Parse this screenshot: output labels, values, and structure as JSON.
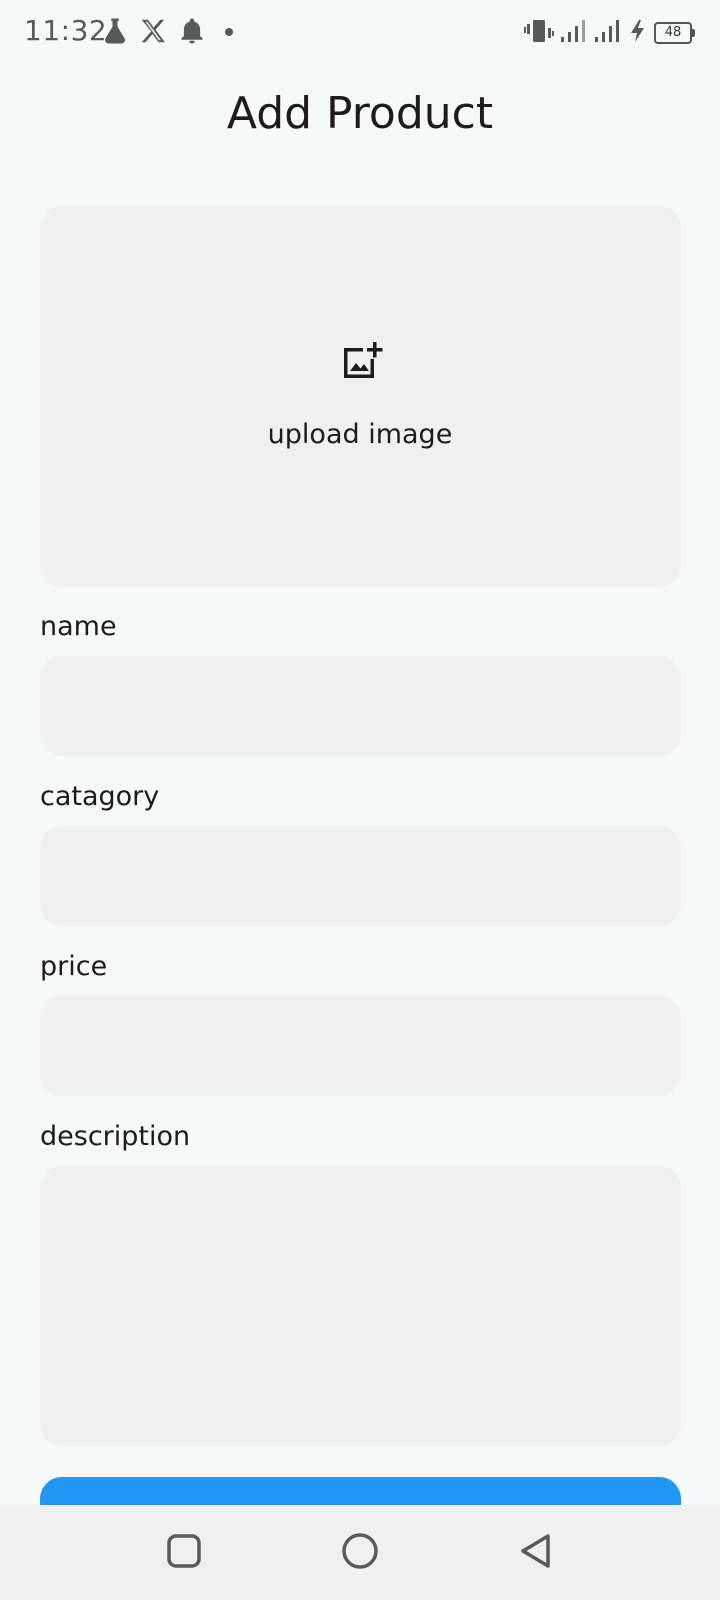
{
  "status_bar": {
    "time": "11:32",
    "battery_level": "48",
    "left_icons": [
      "flask-icon",
      "x-logo-icon",
      "bell-icon",
      "dot-icon"
    ],
    "right_icons": [
      "vibrate-icon",
      "signal-icon",
      "signal-icon",
      "charging-icon",
      "battery-icon"
    ]
  },
  "header": {
    "title": "Add Product"
  },
  "upload": {
    "label": "upload image",
    "icon": "add-photo-icon"
  },
  "form": {
    "name": {
      "label": "name",
      "value": "",
      "placeholder": ""
    },
    "category": {
      "label": "catagory",
      "value": "",
      "placeholder": ""
    },
    "price": {
      "label": "price",
      "value": "",
      "placeholder": ""
    },
    "description": {
      "label": "description",
      "value": "",
      "placeholder": ""
    }
  },
  "submit": {
    "label": ""
  },
  "nav_bar": {
    "items": [
      "recents-icon",
      "home-icon",
      "back-icon"
    ]
  },
  "colors": {
    "background": "#f4f9f9",
    "field_background": "#eff0f0",
    "accent": "#2196f3",
    "nav_background": "#f0f0f0",
    "text": "#1c1c1c"
  }
}
